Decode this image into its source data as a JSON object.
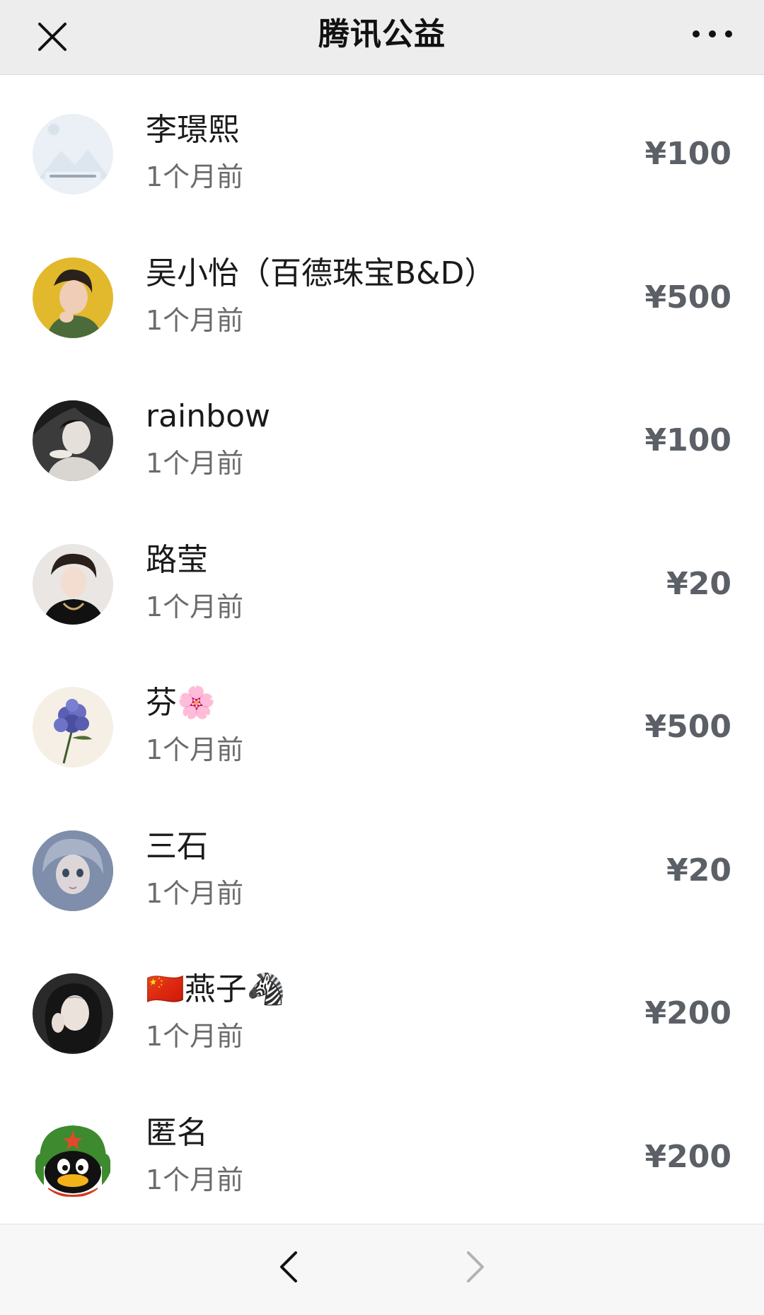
{
  "navbar": {
    "title": "腾讯公益",
    "close_icon": "close-icon",
    "more_icon": "more-dots-icon"
  },
  "donors": [
    {
      "name": "李璟熙",
      "time": "1个月前",
      "amount": "¥100",
      "avatar": "placeholder-image-avatar"
    },
    {
      "name": "吴小怡（百德珠宝B&D）",
      "time": "1个月前",
      "amount": "¥500",
      "avatar": "woman-portrait-yellow-avatar"
    },
    {
      "name": "rainbow",
      "time": "1个月前",
      "amount": "¥100",
      "avatar": "woman-portrait-bw-avatar"
    },
    {
      "name": "路莹",
      "time": "1个月前",
      "amount": "¥20",
      "avatar": "woman-portrait-light-avatar"
    },
    {
      "name": "芬🌸",
      "time": "1个月前",
      "amount": "¥500",
      "avatar": "hydrangea-flower-avatar"
    },
    {
      "name": "三石",
      "time": "1个月前",
      "amount": "¥20",
      "avatar": "doll-face-avatar"
    },
    {
      "name": "🇨🇳燕子🦓",
      "time": "1个月前",
      "amount": "¥200",
      "avatar": "woman-portrait-dark-avatar"
    },
    {
      "name": "匿名",
      "time": "1个月前",
      "amount": "¥200",
      "avatar": "qq-penguin-avatar"
    }
  ],
  "toolbar": {
    "back_icon": "chevron-left-icon",
    "forward_icon": "chevron-right-icon",
    "forward_enabled": false
  },
  "colors": {
    "navbar_bg": "#ededed",
    "amount_text": "#5b5f66",
    "time_text": "#6b6b6b",
    "toolbar_bg": "#f7f7f7"
  }
}
